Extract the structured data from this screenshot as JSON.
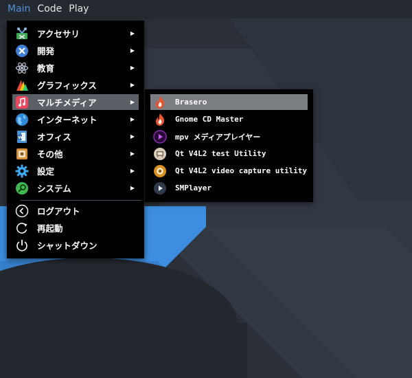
{
  "panel": {
    "items": [
      "Main",
      "Code",
      "Play"
    ]
  },
  "main_menu": {
    "items": [
      {
        "label": "アクセサリ",
        "icon": "accessories-icon",
        "has_submenu": true
      },
      {
        "label": "開発",
        "icon": "development-icon",
        "has_submenu": true
      },
      {
        "label": "教育",
        "icon": "education-icon",
        "has_submenu": true
      },
      {
        "label": "グラフィックス",
        "icon": "graphics-icon",
        "has_submenu": true
      },
      {
        "label": "マルチメディア",
        "icon": "multimedia-icon",
        "has_submenu": true,
        "highlighted": true
      },
      {
        "label": "インターネット",
        "icon": "internet-icon",
        "has_submenu": true
      },
      {
        "label": "オフィス",
        "icon": "office-icon",
        "has_submenu": true
      },
      {
        "label": "その他",
        "icon": "other-icon",
        "has_submenu": true
      },
      {
        "label": "設定",
        "icon": "settings-icon",
        "has_submenu": true
      },
      {
        "label": "システム",
        "icon": "system-icon",
        "has_submenu": true
      }
    ],
    "session": [
      {
        "label": "ログアウト",
        "icon": "logout-icon"
      },
      {
        "label": "再起動",
        "icon": "restart-icon"
      },
      {
        "label": "シャットダウン",
        "icon": "shutdown-icon"
      }
    ],
    "submenu_arrow": "▶"
  },
  "sub_menu": {
    "items": [
      {
        "label": "Brasero",
        "icon": "brasero-icon",
        "highlighted": true
      },
      {
        "label": "Gnome CD Master",
        "icon": "gnome-cd-master-icon"
      },
      {
        "label": "mpv メディアプレイヤー",
        "icon": "mpv-icon"
      },
      {
        "label": "Qt V4L2 test Utility",
        "icon": "qv4l2-icon"
      },
      {
        "label": "Qt V4L2 video capture utility",
        "icon": "qvidcap-icon"
      },
      {
        "label": "SMPlayer",
        "icon": "smplayer-icon"
      }
    ]
  },
  "colors": {
    "panel_bg": "#252a31",
    "panel_active": "#4f8fd8",
    "menu_bg": "#000000",
    "highlight_main": "#5b5f66",
    "highlight_sub": "#7a7d82",
    "wallpaper_blue": "#3d8ee0"
  }
}
